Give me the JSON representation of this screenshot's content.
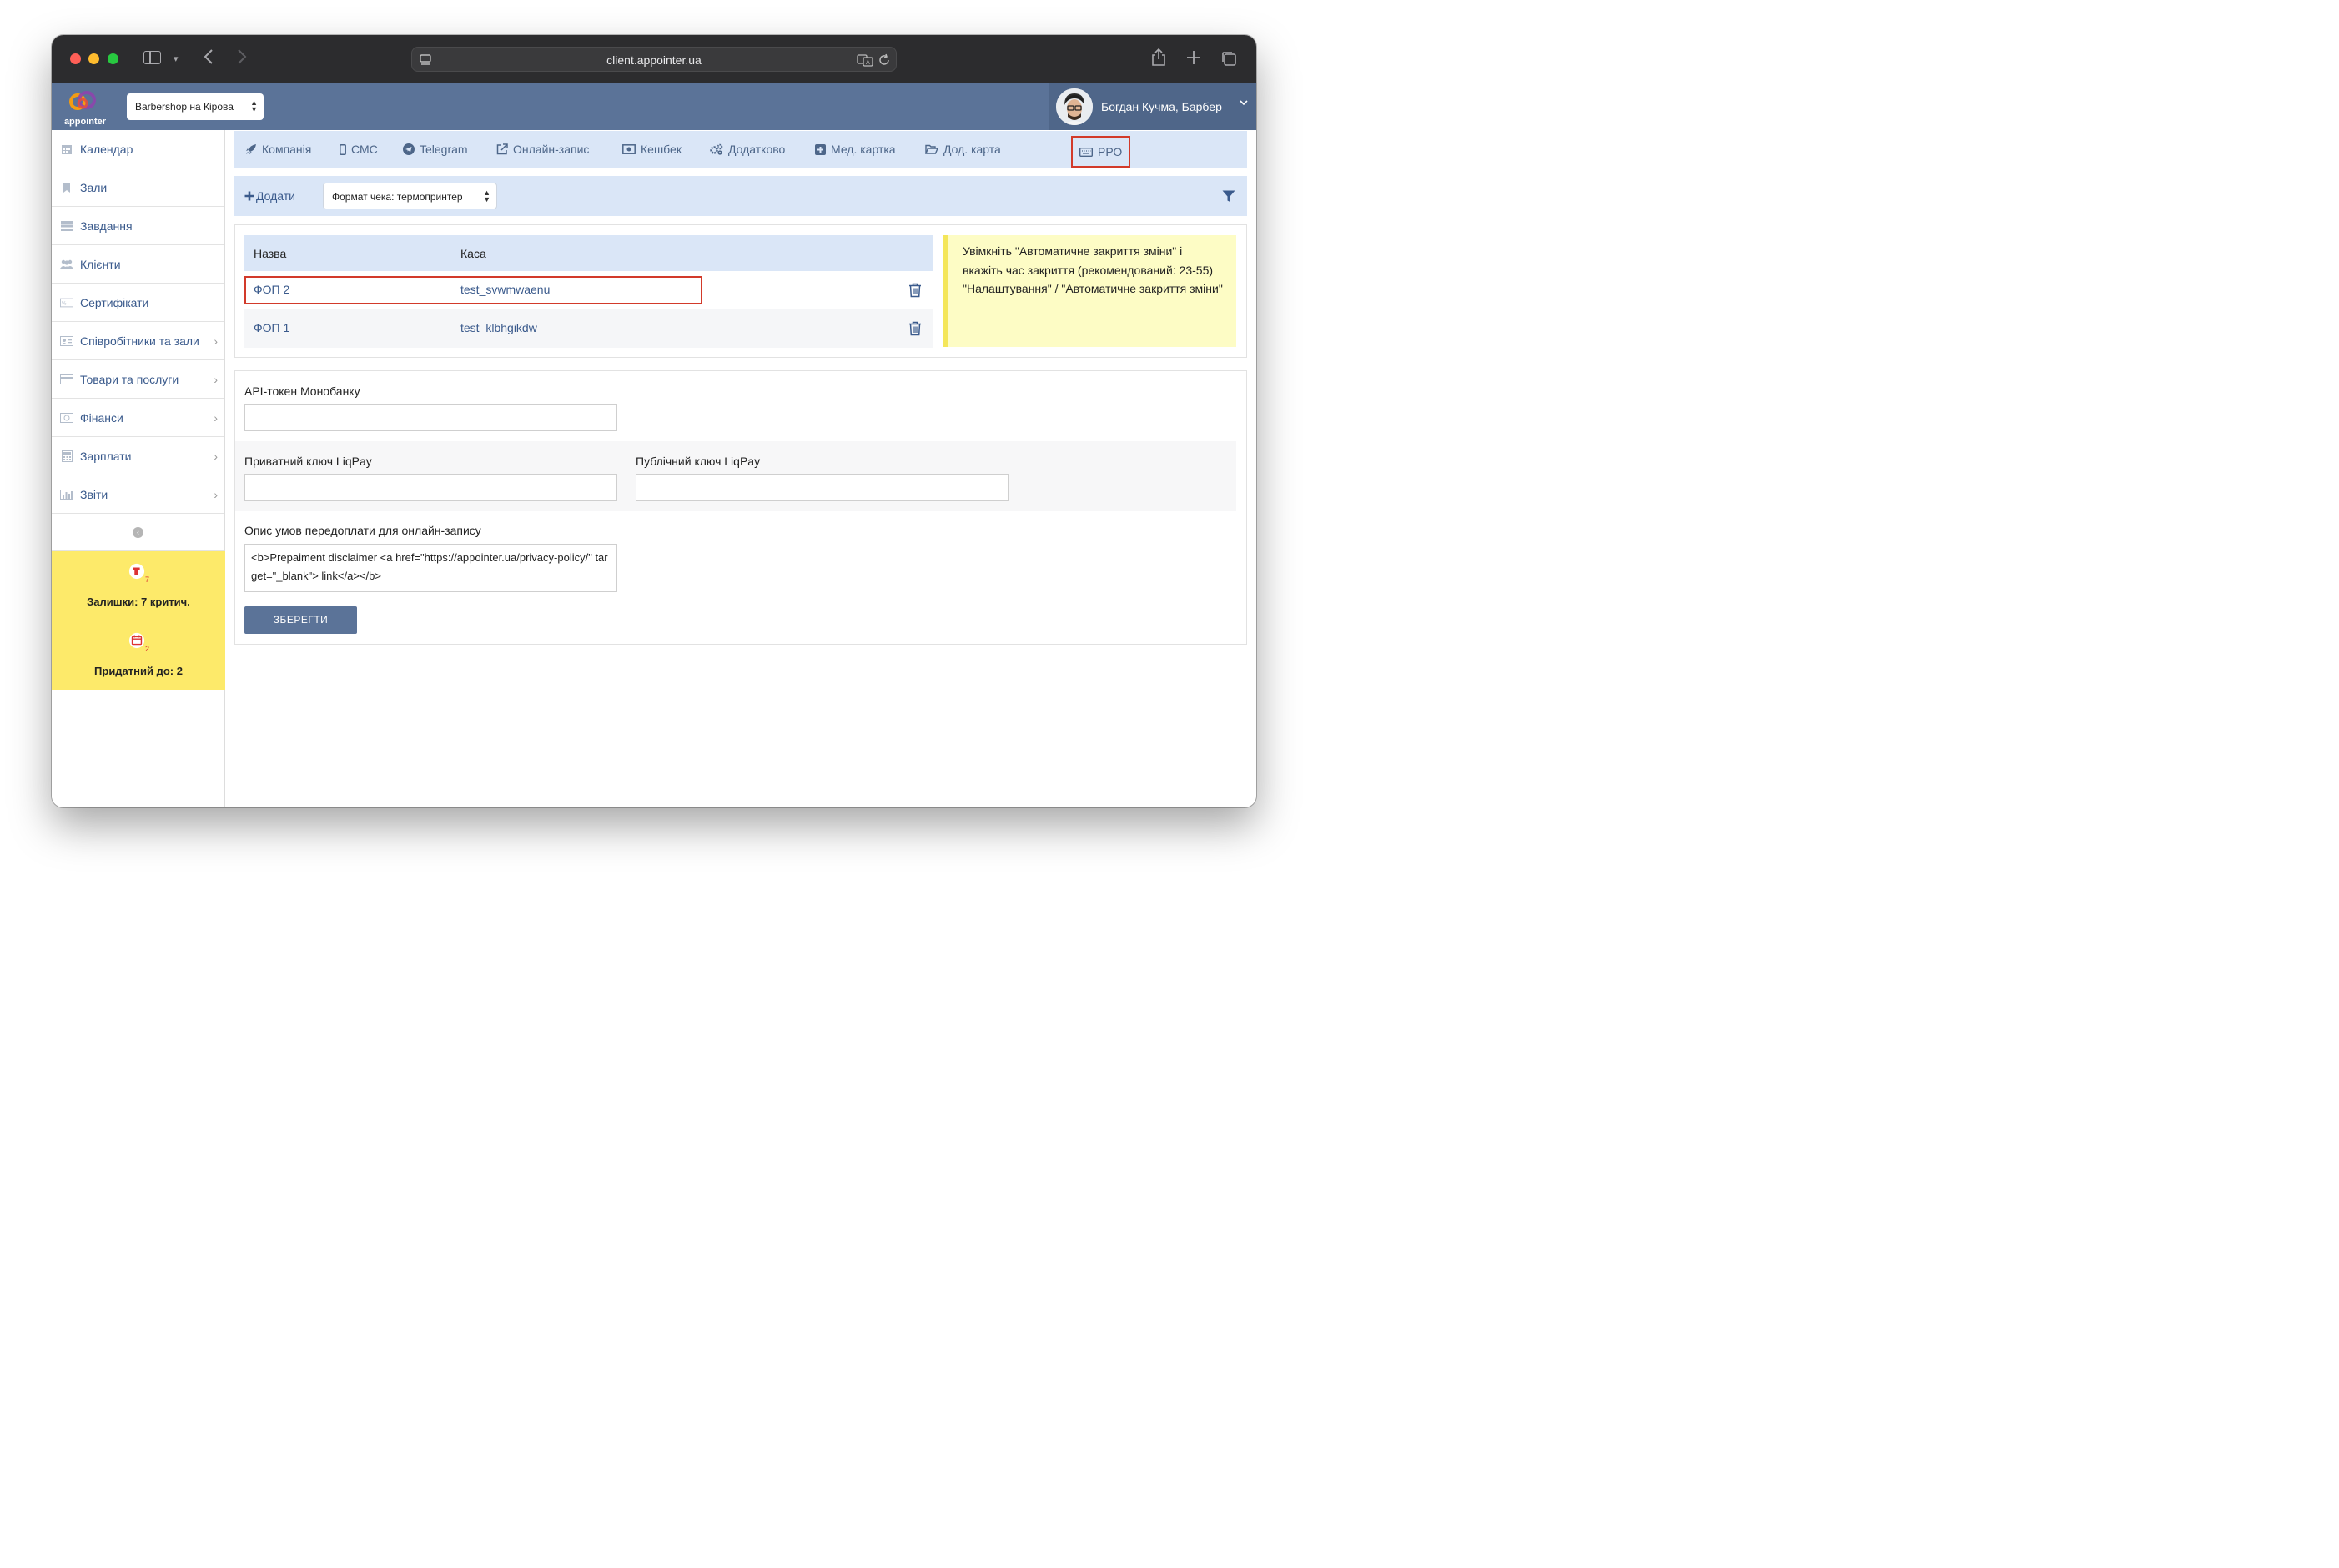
{
  "browser": {
    "url": "client.appointer.ua"
  },
  "header": {
    "logo_text": "appointer",
    "branch": "Barbershop на Кірова",
    "user": "Богдан Кучма, Барбер"
  },
  "sidebar": {
    "items": [
      {
        "label": "Календар",
        "icon": "calendar-icon",
        "arrow": false
      },
      {
        "label": "Зали",
        "icon": "bookmark-icon",
        "arrow": false
      },
      {
        "label": "Завдання",
        "icon": "tasks-icon",
        "arrow": false
      },
      {
        "label": "Клієнти",
        "icon": "users-icon",
        "arrow": false
      },
      {
        "label": "Сертифікати",
        "icon": "certificate-icon",
        "arrow": false
      },
      {
        "label": "Співробітники та зали",
        "icon": "staff-icon",
        "arrow": true
      },
      {
        "label": "Товари та послуги",
        "icon": "card-icon",
        "arrow": true
      },
      {
        "label": "Фінанси",
        "icon": "money-icon",
        "arrow": true
      },
      {
        "label": "Зарплати",
        "icon": "calculator-icon",
        "arrow": true
      },
      {
        "label": "Звіти",
        "icon": "chart-icon",
        "arrow": true
      }
    ],
    "warnings": {
      "stock_badge": "7",
      "stock_text": "Залишки: 7 критич.",
      "expiry_badge": "2",
      "expiry_text": "Придатний до: 2"
    }
  },
  "tabs": [
    {
      "label": "Компанія",
      "icon": "rocket-icon"
    },
    {
      "label": "СМС",
      "icon": "phone-icon"
    },
    {
      "label": "Telegram",
      "icon": "telegram-icon"
    },
    {
      "label": "Онлайн-запис",
      "icon": "external-link-icon"
    },
    {
      "label": "Кешбек",
      "icon": "money-icon"
    },
    {
      "label": "Додатково",
      "icon": "gears-icon"
    },
    {
      "label": "Мед. картка",
      "icon": "plus-square-icon"
    },
    {
      "label": "Дод. карта",
      "icon": "folder-open-icon"
    },
    {
      "label": "РРО",
      "icon": "keyboard-icon",
      "active": true
    }
  ],
  "toolbar": {
    "add_label": "Додати",
    "format_select": "Формат чека: термопринтер"
  },
  "table": {
    "columns": [
      "Назва",
      "Каса"
    ],
    "rows": [
      {
        "name": "ФОП 2",
        "cash": "test_svwmwaenu"
      },
      {
        "name": "ФОП 1",
        "cash": "test_klbhgikdw"
      }
    ]
  },
  "notice": {
    "line1": "Увімкніть \"Автоматичне закриття зміни\" і вкажіть час закриття (рекомендований: 23-55)",
    "line2": "\"Налаштування\" / \"Автоматичне закриття зміни\""
  },
  "form": {
    "mono_label": "API-токен Монобанку",
    "liq_private_label": "Приватний ключ LiqPay",
    "liq_public_label": "Публічний ключ LiqPay",
    "prepay_label": "Опис умов передоплати для онлайн-запису",
    "prepay_value": "<b>Prepaiment disclaimer <a href=\"https://appointer.ua/privacy-policy/\" target=\"_blank\"> link</a></b>",
    "save_label": "ЗБЕРЕГТИ"
  },
  "colors": {
    "header": "#5b7398",
    "tab_bg": "#dae6f7",
    "highlight": "#d23a2a",
    "notice_bg": "#fdfcc5",
    "warning_bg": "#fdea6a"
  }
}
